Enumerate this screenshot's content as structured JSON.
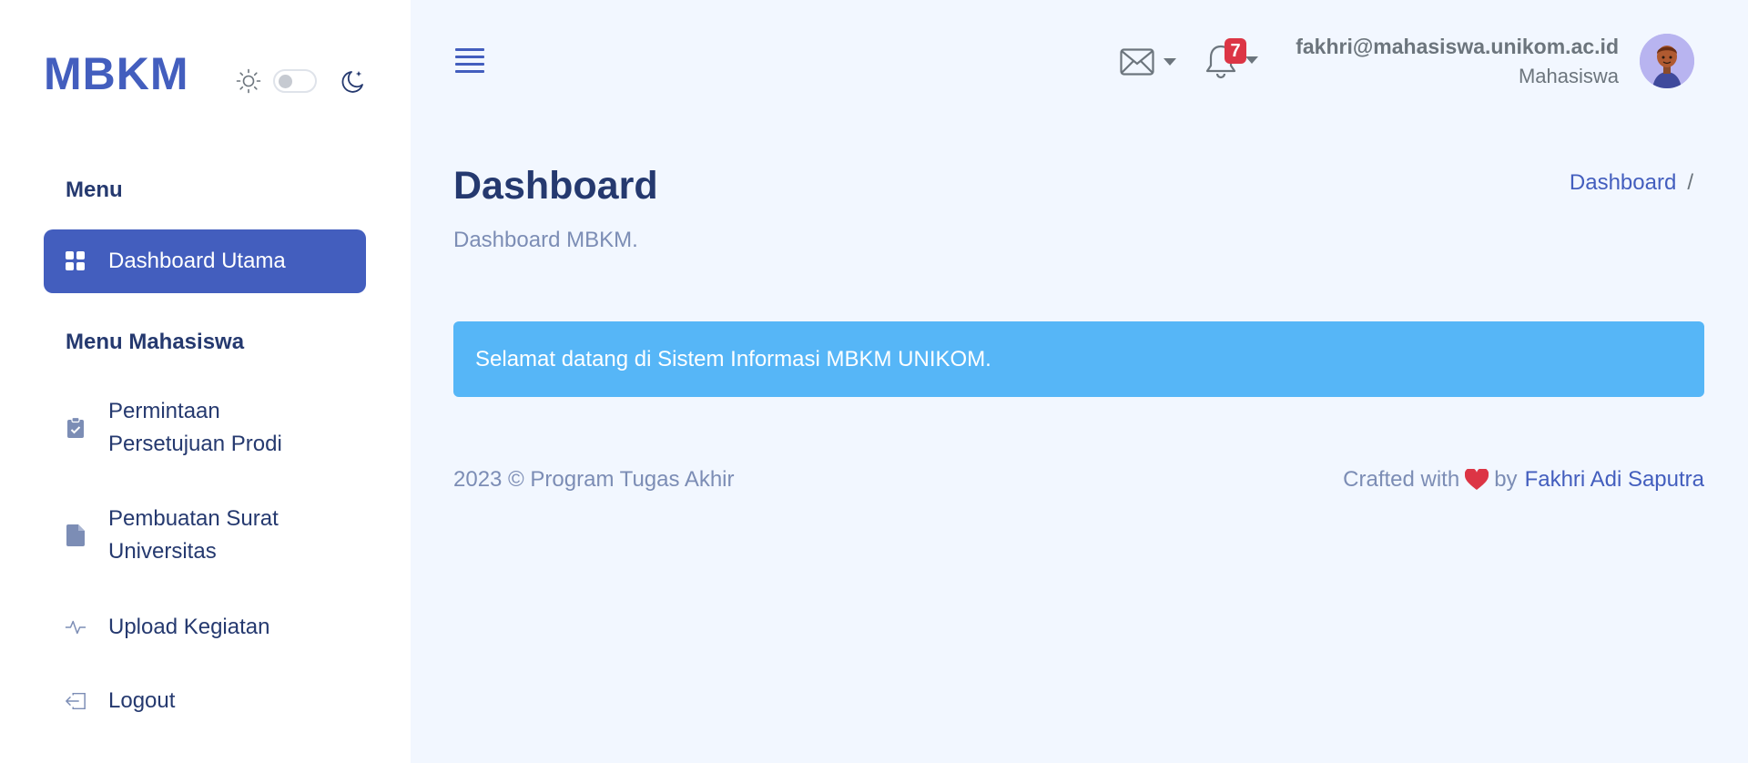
{
  "app": {
    "logo": "MBKM"
  },
  "sidebar": {
    "sections": [
      {
        "title": "Menu"
      },
      {
        "title": "Menu Mahasiswa"
      }
    ],
    "items": [
      {
        "label": "Dashboard Utama",
        "icon": "grid-icon",
        "active": true
      },
      {
        "label": "Permintaan Persetujuan Prodi",
        "icon": "clipboard-check-icon"
      },
      {
        "label": "Pembuatan Surat Universitas",
        "icon": "file-icon"
      },
      {
        "label": "Upload Kegiatan",
        "icon": "activity-icon"
      },
      {
        "label": "Logout",
        "icon": "logout-icon"
      }
    ]
  },
  "header": {
    "notification_count": "7",
    "user_email": "fakhri@mahasiswa.unikom.ac.id",
    "user_role": "Mahasiswa"
  },
  "page": {
    "title": "Dashboard",
    "subtitle": "Dashboard MBKM.",
    "breadcrumb": "Dashboard",
    "breadcrumb_sep": "/"
  },
  "alert": {
    "message": "Selamat datang di Sistem Informasi MBKM UNIKOM."
  },
  "footer": {
    "left": "2023 © Program Tugas Akhir",
    "crafted": "Crafted with",
    "by": "by",
    "author": "Fakhri Adi Saputra"
  },
  "colors": {
    "primary": "#435ebe",
    "background": "#f2f7ff",
    "alert": "#56b6f7",
    "badge": "#dc3545",
    "heart": "#dc3545"
  }
}
